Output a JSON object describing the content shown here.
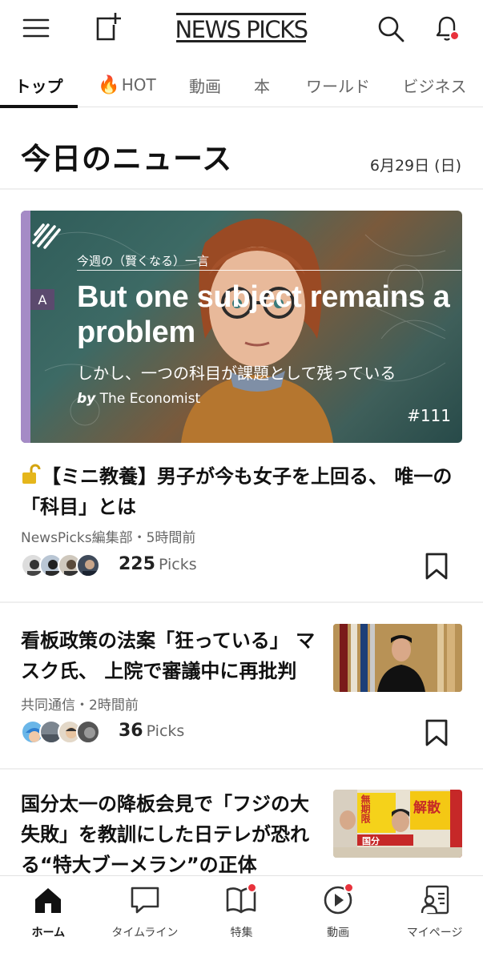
{
  "header": {
    "logo": "NEWS PICKS",
    "icons": [
      "menu-icon",
      "post-icon",
      "search-icon",
      "bell-icon"
    ],
    "notification_dot_color": "#e8323c"
  },
  "tabs": [
    {
      "label": "トップ",
      "active": true
    },
    {
      "label": "HOT",
      "icon": "flame-icon"
    },
    {
      "label": "動画"
    },
    {
      "label": "本"
    },
    {
      "label": "ワールド"
    },
    {
      "label": "ビジネス"
    }
  ],
  "section": {
    "title": "今日のニュース",
    "date": "6月29日 (日)"
  },
  "feature": {
    "kicker": "今週の（賢くなる）一言",
    "badge": "A",
    "title": "But one subject remains a problem",
    "subtitle": "しかし、一つの科目が課題として残っている",
    "by": "by",
    "source": "The Economist",
    "number": "#111",
    "accent_color": "#a58bc6"
  },
  "articles": [
    {
      "title": "【ミニ教養】男子が今も女子を上回る、 唯一の「科目」とは",
      "source": "NewsPicks編集部",
      "time": "5時間前",
      "picks_count": "225",
      "picks_label": "Picks",
      "locked": true
    },
    {
      "title": "看板政策の法案「狂っている」 マスク氏、 上院で審議中に再批判",
      "source": "共同通信",
      "time": "2時間前",
      "picks_count": "36",
      "picks_label": "Picks"
    },
    {
      "title": "国分太一の降板会見で「フジの大失敗」を教訓にした日テレが恐れる“特大ブーメラン”の正体",
      "thumb_texts": [
        "無期限",
        "解散",
        "国分"
      ]
    }
  ],
  "meta_separator": "・",
  "bottom_nav": [
    {
      "label": "ホーム",
      "icon": "home-icon",
      "active": true
    },
    {
      "label": "タイムライン",
      "icon": "timeline-icon"
    },
    {
      "label": "特集",
      "icon": "book-icon",
      "badge": true
    },
    {
      "label": "動画",
      "icon": "video-play-icon",
      "badge": true
    },
    {
      "label": "マイページ",
      "icon": "profile-icon"
    }
  ]
}
